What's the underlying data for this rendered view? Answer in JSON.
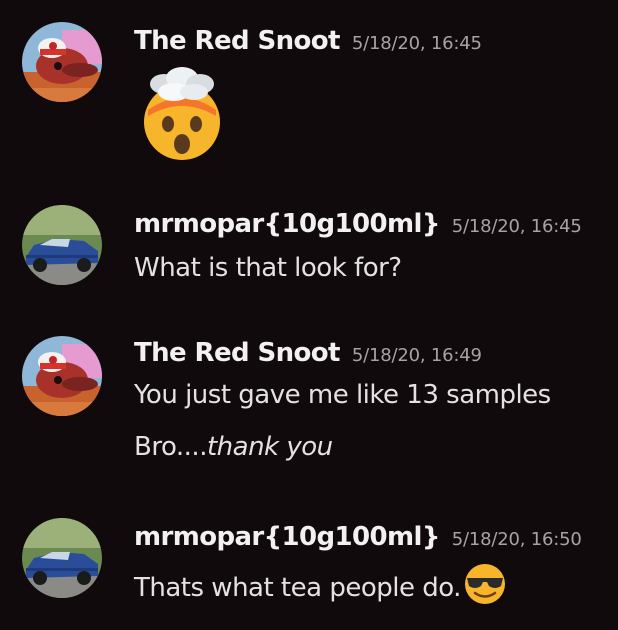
{
  "messages": [
    {
      "author": "The Red Snoot",
      "timestamp": "5/18/20, 16:45",
      "avatar_icon": "red-snoot-avatar",
      "emoji": "exploding-head-emoji"
    },
    {
      "author": "mrmopar{10g100ml}",
      "timestamp": "5/18/20, 16:45",
      "avatar_icon": "blue-car-avatar",
      "text": "What is that look for?"
    },
    {
      "author": "The Red Snoot",
      "timestamp": "5/18/20, 16:49",
      "avatar_icon": "red-snoot-avatar",
      "text": "You just gave me like 13 samples",
      "text2_prefix": "Bro....",
      "text2_italic": "thank you"
    },
    {
      "author": "mrmopar{10g100ml}",
      "timestamp": "5/18/20, 16:50",
      "avatar_icon": "blue-car-avatar",
      "text": "Thats what tea people do.",
      "emoji": "sunglasses-face-emoji"
    }
  ],
  "colors": {
    "background": "#110a0d",
    "username": "#f2f0f1",
    "timestamp": "#a7a2a5",
    "message_text": "#e4e1e3"
  }
}
